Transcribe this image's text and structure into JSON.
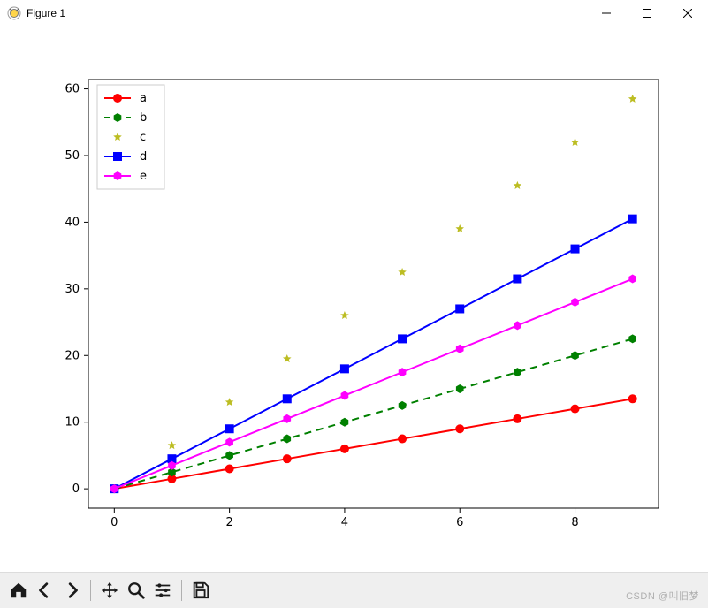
{
  "window": {
    "title": "Figure 1",
    "controls": {
      "minimize": "–",
      "maximize": "☐",
      "close": "✕"
    }
  },
  "watermark": "CSDN @叫旧梦",
  "toolbar_icons": {
    "home": "home-icon",
    "back": "back-icon",
    "forward": "forward-icon",
    "pan": "pan-icon",
    "zoom": "zoom-icon",
    "subplots": "subplots-icon",
    "save": "save-icon"
  },
  "chart_data": {
    "type": "line",
    "x": [
      0,
      1,
      2,
      3,
      4,
      5,
      6,
      7,
      8,
      9
    ],
    "series": [
      {
        "name": "a",
        "values": [
          0,
          1.5,
          3,
          4.5,
          6,
          7.5,
          9,
          10.5,
          12,
          13.5
        ],
        "color": "#ff0000",
        "marker": "circle",
        "line": "solid"
      },
      {
        "name": "b",
        "values": [
          0,
          2.5,
          5,
          7.5,
          10,
          12.5,
          15,
          17.5,
          20,
          22.5
        ],
        "color": "#008000",
        "marker": "hexagon",
        "line": "dashed"
      },
      {
        "name": "c",
        "values": [
          0,
          6.5,
          13,
          19.5,
          26,
          32.5,
          39,
          45.5,
          52,
          58.5
        ],
        "color": "#bcbd22",
        "marker": "star",
        "line": "none"
      },
      {
        "name": "d",
        "values": [
          0,
          4.5,
          9,
          13.5,
          18,
          22.5,
          27,
          31.5,
          36,
          40.5
        ],
        "color": "#0000ff",
        "marker": "square",
        "line": "solid"
      },
      {
        "name": "e",
        "values": [
          0,
          3.5,
          7,
          10.5,
          14,
          17.5,
          21,
          24.5,
          28,
          31.5
        ],
        "color": "#ff00ff",
        "marker": "hexagon",
        "line": "solid"
      }
    ],
    "xticks": [
      0,
      2,
      4,
      6,
      8
    ],
    "yticks": [
      0,
      10,
      20,
      30,
      40,
      50,
      60
    ],
    "xlim": [
      -0.45,
      9.45
    ],
    "ylim": [
      -2.9,
      61.4
    ],
    "xlabel": "",
    "ylabel": "",
    "title": "",
    "legend_position": "upper-left",
    "grid": false
  }
}
